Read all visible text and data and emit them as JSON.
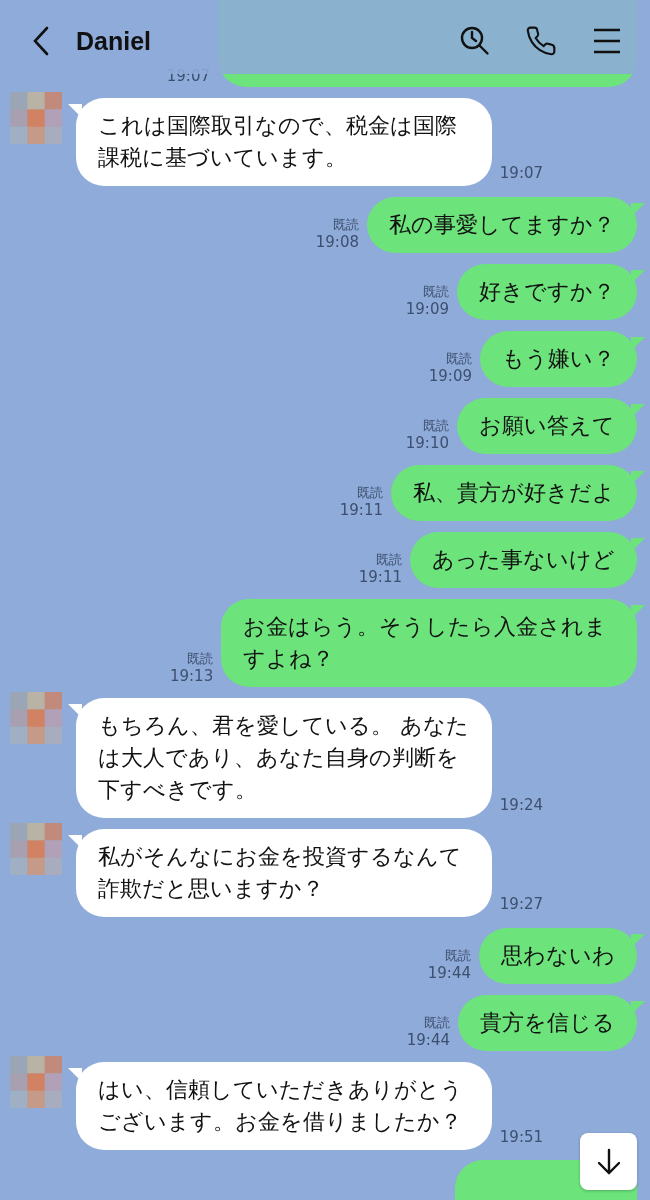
{
  "header": {
    "title": "Daniel"
  },
  "messages": [
    {
      "kind": "sent_partial",
      "time": "19:07"
    },
    {
      "kind": "received",
      "text": "これは国際取引なので、税金は国際課税に基づいています。",
      "time": "19:07"
    },
    {
      "kind": "sent",
      "text": "私の事愛してますか？",
      "read_label": "既読",
      "time": "19:08"
    },
    {
      "kind": "sent",
      "text": "好きですか？",
      "read_label": "既読",
      "time": "19:09"
    },
    {
      "kind": "sent",
      "text": "もう嫌い？",
      "read_label": "既読",
      "time": "19:09"
    },
    {
      "kind": "sent",
      "text": "お願い答えて",
      "read_label": "既読",
      "time": "19:10"
    },
    {
      "kind": "sent",
      "text": "私、貴方が好きだよ",
      "read_label": "既読",
      "time": "19:11"
    },
    {
      "kind": "sent",
      "text": "あった事ないけど",
      "read_label": "既読",
      "time": "19:11"
    },
    {
      "kind": "sent",
      "text": "お金はらう。そうしたら入金されますよね？",
      "read_label": "既読",
      "time": "19:13"
    },
    {
      "kind": "received",
      "text": "もちろん、君を愛している。 あなたは大人であり、あなた自身の判断を下すべきです。",
      "time": "19:24"
    },
    {
      "kind": "received",
      "text": "私がそんなにお金を投資するなんて詐欺だと思いますか？",
      "time": "19:27"
    },
    {
      "kind": "sent",
      "text": "思わないわ",
      "read_label": "既読",
      "time": "19:44"
    },
    {
      "kind": "sent",
      "text": "貴方を信じる",
      "read_label": "既読",
      "time": "19:44"
    },
    {
      "kind": "received",
      "text": "はい、信頼していただきありがとうございます。お金を借りましたか？",
      "time": "19:51"
    },
    {
      "kind": "sent_partial"
    }
  ]
}
